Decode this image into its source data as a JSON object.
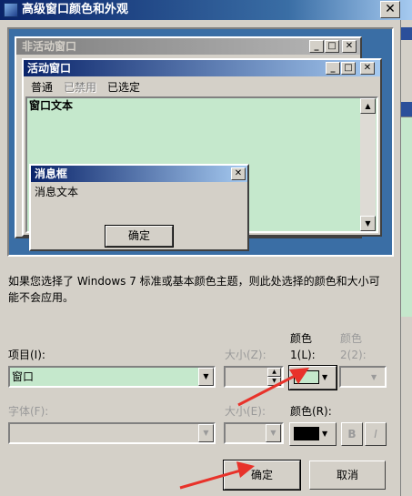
{
  "dialog": {
    "title": "高级窗口颜色和外观",
    "close_glyph": "✕"
  },
  "preview": {
    "inactive_title": "非活动窗口",
    "active_title": "活动窗口",
    "menu": [
      "普通",
      "已禁用",
      "已选定"
    ],
    "window_text": "窗口文本",
    "msgbox_title": "消息框",
    "msgbox_text": "消息文本",
    "msgbox_ok": "确定"
  },
  "info_text": "如果您选择了 Windows 7 标准或基本颜色主题，则此处选择的颜色和大小可能不会应用。",
  "item": {
    "label": "项目(I):",
    "value": "窗口",
    "size_label": "大小(Z):",
    "color1_label_line1": "颜色",
    "color1_label_line2": "1(L):",
    "color2_label_line1": "颜色",
    "color2_label_line2": "2(2):",
    "color1_value": "#c5e8cc"
  },
  "font": {
    "label": "字体(F):",
    "size_label": "大小(E):",
    "color_label": "颜色(R):",
    "color_value": "#000000",
    "bold_label": "B",
    "italic_label": "I"
  },
  "buttons": {
    "ok": "确定",
    "cancel": "取消"
  },
  "colors": {
    "titlebar_active": "#0a246a",
    "preview_desktop": "#3a6ea5",
    "window_background": "#c5e8cc",
    "annotation_arrow": "#e8322a"
  },
  "icons": {
    "title_icon": "window-icon",
    "combo_arrow": "chevron-down-icon",
    "scroll_up": "scroll-up-icon",
    "scroll_down": "scroll-down-icon"
  }
}
